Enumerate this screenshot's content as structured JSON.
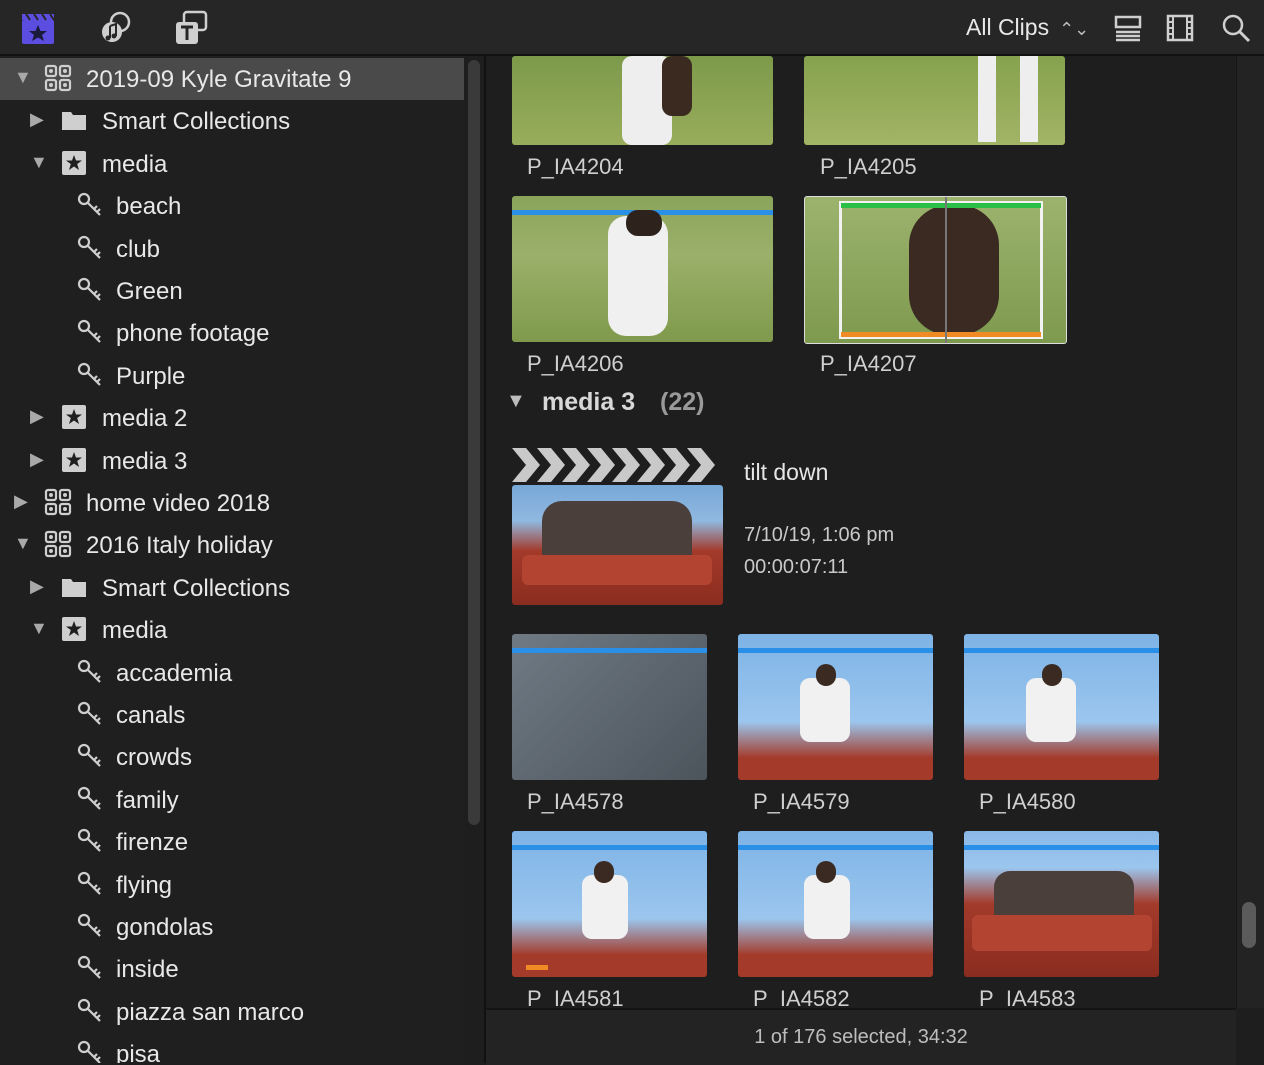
{
  "toolbar": {
    "icons": [
      "libraries-icon",
      "photos-audio-icon",
      "titles-generators-icon",
      "list-view-icon",
      "filmstrip-icon",
      "search-icon"
    ],
    "filter_label": "All Clips"
  },
  "sidebar": {
    "items": [
      {
        "label": "2019-09 Kyle Gravitate 9",
        "type": "library",
        "expanded": true,
        "selected": true
      },
      {
        "label": "Smart Collections",
        "type": "folder",
        "expanded": false
      },
      {
        "label": "media",
        "type": "event",
        "expanded": true
      },
      {
        "label": "beach",
        "type": "keyword"
      },
      {
        "label": "club",
        "type": "keyword"
      },
      {
        "label": "Green",
        "type": "keyword"
      },
      {
        "label": "phone footage",
        "type": "keyword"
      },
      {
        "label": "Purple",
        "type": "keyword"
      },
      {
        "label": "media 2",
        "type": "event",
        "expanded": false
      },
      {
        "label": "media 3",
        "type": "event",
        "expanded": false
      },
      {
        "label": "home video 2018",
        "type": "library",
        "expanded": false
      },
      {
        "label": "2016 Italy holiday",
        "type": "library",
        "expanded": true
      },
      {
        "label": "Smart Collections",
        "type": "folder",
        "expanded": false
      },
      {
        "label": "media",
        "type": "event",
        "expanded": true
      },
      {
        "label": "accademia",
        "type": "keyword"
      },
      {
        "label": "canals",
        "type": "keyword"
      },
      {
        "label": "crowds",
        "type": "keyword"
      },
      {
        "label": "family",
        "type": "keyword"
      },
      {
        "label": "firenze",
        "type": "keyword"
      },
      {
        "label": "flying",
        "type": "keyword"
      },
      {
        "label": "gondolas",
        "type": "keyword"
      },
      {
        "label": "inside",
        "type": "keyword"
      },
      {
        "label": "piazza san marco",
        "type": "keyword"
      },
      {
        "label": "pisa",
        "type": "keyword"
      }
    ]
  },
  "browser": {
    "top_clips": [
      "P_IA4204",
      "P_IA4205",
      "P_IA4206",
      "P_IA4207"
    ],
    "event_group": {
      "name": "media 3",
      "count": "(22)"
    },
    "expanded_clip": {
      "name": "tilt down",
      "date": "7/10/19, 1:06 pm",
      "duration": "00:00:07:11"
    },
    "clips": [
      "P_IA4578",
      "P_IA4579",
      "P_IA4580",
      "P_IA4581",
      "P_IA4582",
      "P_IA4583"
    ]
  },
  "status": {
    "text": "1 of 176 selected, 34:32"
  },
  "colors": {
    "accent_blue": "#2a8fe6",
    "selection_green": "#2bbf4a",
    "selection_orange": "#f08a24",
    "icon_purple": "#5b4de0"
  }
}
